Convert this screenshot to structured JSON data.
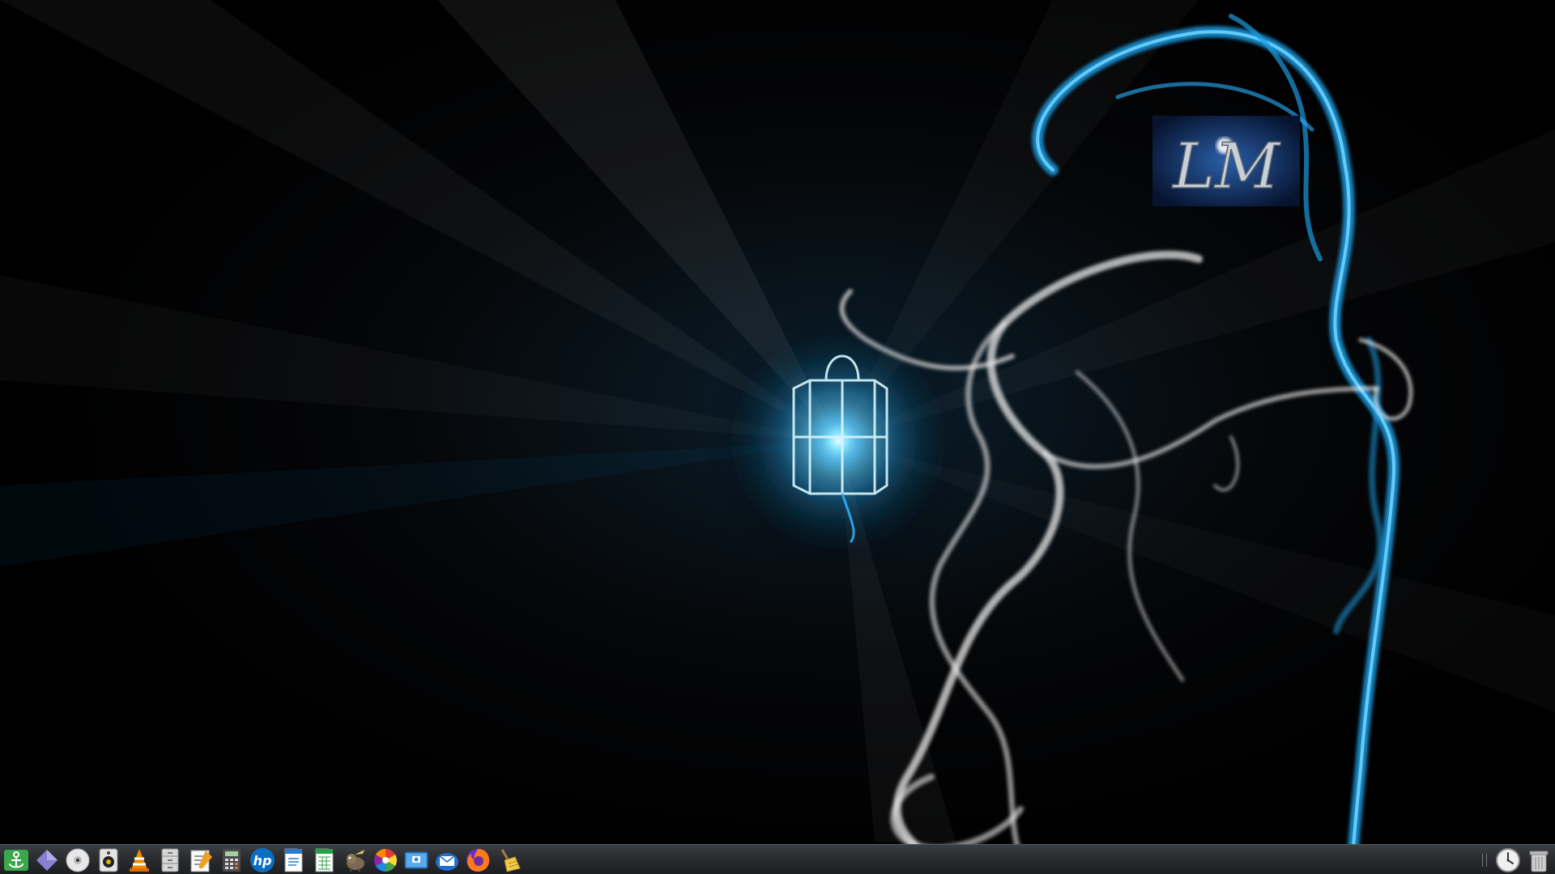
{
  "desktop": {
    "wallpaper": {
      "description_icon": "smoke-reaper-with-lantern",
      "logo_text": "LM",
      "colors": {
        "smoke_blue": "#1a9be0",
        "smoke_white": "#e8e8e8",
        "lantern_glow": "#7fe3ff",
        "background": "#000000"
      }
    }
  },
  "taskbar": {
    "background": "#2c2e31",
    "launchers": [
      {
        "id": "anchor",
        "icon": "anchor-app-icon",
        "tooltip": ""
      },
      {
        "id": "diamond",
        "icon": "purple-diamond-icon",
        "tooltip": ""
      },
      {
        "id": "disc",
        "icon": "optical-disc-icon",
        "tooltip": ""
      },
      {
        "id": "speaker",
        "icon": "speaker-icon",
        "tooltip": ""
      },
      {
        "id": "vlc",
        "icon": "vlc-cone-icon",
        "tooltip": ""
      },
      {
        "id": "file-cabinet",
        "icon": "file-cabinet-icon",
        "tooltip": ""
      },
      {
        "id": "text-editor",
        "icon": "text-editor-icon",
        "tooltip": ""
      },
      {
        "id": "calculator",
        "icon": "calculator-icon",
        "tooltip": ""
      },
      {
        "id": "hp",
        "icon": "hp-logo-icon",
        "label": "hp",
        "tooltip": ""
      },
      {
        "id": "writer",
        "icon": "document-writer-icon",
        "tooltip": ""
      },
      {
        "id": "calc-sheet",
        "icon": "spreadsheet-icon",
        "tooltip": ""
      },
      {
        "id": "gimp",
        "icon": "gimp-icon",
        "tooltip": ""
      },
      {
        "id": "color-wheel",
        "icon": "color-wheel-icon",
        "tooltip": ""
      },
      {
        "id": "screenshot",
        "icon": "screenshot-icon",
        "tooltip": ""
      },
      {
        "id": "mail",
        "icon": "mail-client-icon",
        "tooltip": ""
      },
      {
        "id": "firefox",
        "icon": "firefox-icon",
        "tooltip": ""
      },
      {
        "id": "cleaner",
        "icon": "broom-cleaner-icon",
        "tooltip": ""
      }
    ],
    "tray": [
      {
        "id": "clock",
        "icon": "analog-clock-icon"
      },
      {
        "id": "trash",
        "icon": "trash-can-icon"
      }
    ]
  }
}
